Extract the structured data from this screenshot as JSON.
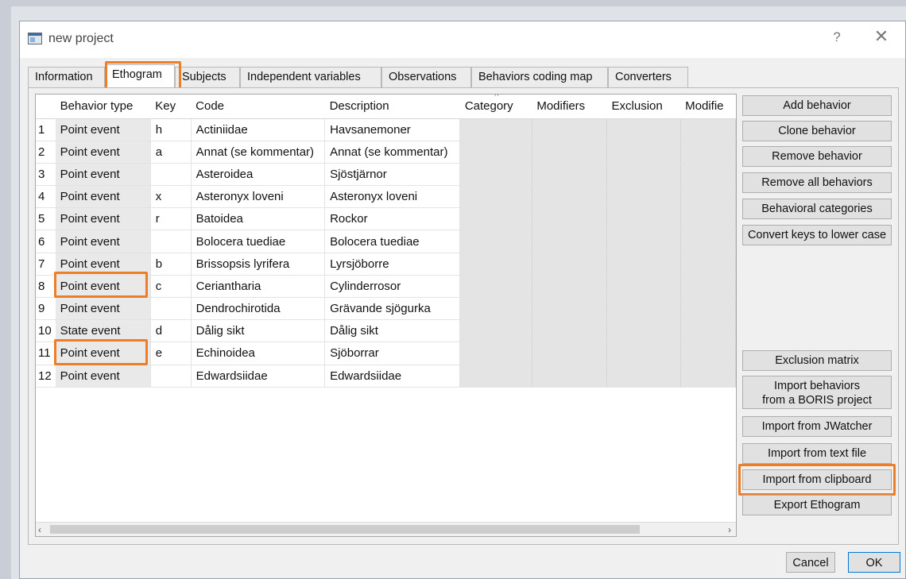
{
  "window": {
    "title": "new project",
    "help_glyph": "?",
    "close_glyph": "✕"
  },
  "tabs": [
    {
      "label": "Information"
    },
    {
      "label": "Ethogram",
      "active": true
    },
    {
      "label": "Subjects"
    },
    {
      "label": "Independent variables"
    },
    {
      "label": "Observations"
    },
    {
      "label": "Behaviors coding map"
    },
    {
      "label": "Converters"
    }
  ],
  "table": {
    "columns": [
      "Behavior type",
      "Key",
      "Code",
      "Description",
      "Category",
      "Modifiers",
      "Exclusion",
      "Modifie"
    ],
    "rows": [
      {
        "num": "1",
        "type": "Point event",
        "key": "h",
        "code": "Actiniidae",
        "description": "Havsanemoner"
      },
      {
        "num": "2",
        "type": "Point event",
        "key": "a",
        "code": "Annat (se kommentar)",
        "description": "Annat (se kommentar)"
      },
      {
        "num": "3",
        "type": "Point event",
        "key": "",
        "code": "Asteroidea",
        "description": "Sjöstjärnor"
      },
      {
        "num": "4",
        "type": "Point event",
        "key": "x",
        "code": "Asteronyx loveni",
        "description": "Asteronyx loveni"
      },
      {
        "num": "5",
        "type": "Point event",
        "key": "r",
        "code": "Batoidea",
        "description": "Rockor"
      },
      {
        "num": "6",
        "type": "Point event",
        "key": "",
        "code": "Bolocera tuediae",
        "description": "Bolocera tuediae"
      },
      {
        "num": "7",
        "type": "Point event",
        "key": "b",
        "code": "Brissopsis lyrifera",
        "description": "Lyrsjöborre"
      },
      {
        "num": "8",
        "type": "Point event",
        "key": "c",
        "code": "Ceriantharia",
        "description": "Cylinderrosor"
      },
      {
        "num": "9",
        "type": "Point event",
        "key": "",
        "code": "Dendrochirotida",
        "description": "Grävande sjögurka"
      },
      {
        "num": "10",
        "type": "State event",
        "key": "d",
        "code": "Dålig sikt",
        "description": "Dålig sikt"
      },
      {
        "num": "11",
        "type": "Point event",
        "key": "e",
        "code": "Echinoidea",
        "description": "Sjöborrar"
      },
      {
        "num": "12",
        "type": "Point event",
        "key": "",
        "code": "Edwardsiidae",
        "description": "Edwardsiidae"
      }
    ]
  },
  "side_buttons": {
    "add": "Add behavior",
    "clone": "Clone behavior",
    "remove": "Remove behavior",
    "remove_all": "Remove all behaviors",
    "categories": "Behavioral categories",
    "lower_case": "Convert keys to lower case",
    "exclusion": "Exclusion matrix",
    "import_boris_line1": "Import behaviors",
    "import_boris_line2": "from a BORIS project",
    "import_jwatcher": "Import from JWatcher",
    "import_text": "Import from text file",
    "import_clipboard": "Import from clipboard",
    "export": "Export Ethogram"
  },
  "dialog": {
    "cancel": "Cancel",
    "ok": "OK"
  },
  "colors": {
    "highlight": "#ee7d28",
    "accent": "#0078d7"
  },
  "icons": {
    "app": "window-app-icon",
    "scroll_left": "‹",
    "scroll_right": "›"
  }
}
